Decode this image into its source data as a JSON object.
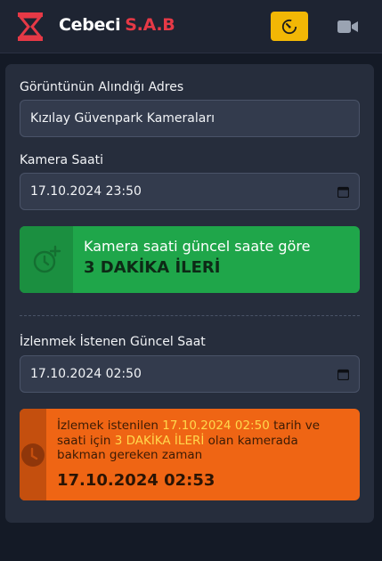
{
  "header": {
    "brand_main": "Cebeci",
    "brand_accent": "S.A.B",
    "icons": {
      "logo": "hourglass-logo-icon",
      "timer": "timer-icon",
      "camera": "video-camera-icon"
    },
    "colors": {
      "accent_red": "#e63946",
      "timer_button": "#f2b705"
    }
  },
  "form": {
    "address_label": "Görüntünün Alındığı Adres",
    "address_value": "Kızılay Güvenpark Kameraları",
    "camera_time_label": "Kamera Saati",
    "camera_time_value": "17.10.2024 23:50",
    "target_time_label": "İzlenmek İstenen Güncel Saat",
    "target_time_value": "17.10.2024 02:50"
  },
  "offset_alert": {
    "text": "Kamera saati güncel saate göre",
    "value": "3 DAKİKA İLERİ",
    "icon": "clock-plus-icon",
    "color": "#1fa64a"
  },
  "result_alert": {
    "part1": "İzlemek istenilen ",
    "time_highlight": "17.10.2024 02:50",
    "part2": " tarih ve saati için ",
    "offset_highlight": "3 DAKİKA İLERİ",
    "part3": " olan kamerada bakman gereken zaman",
    "result": "17.10.2024 02:53",
    "icon": "clock-icon",
    "color": "#ef6514"
  }
}
